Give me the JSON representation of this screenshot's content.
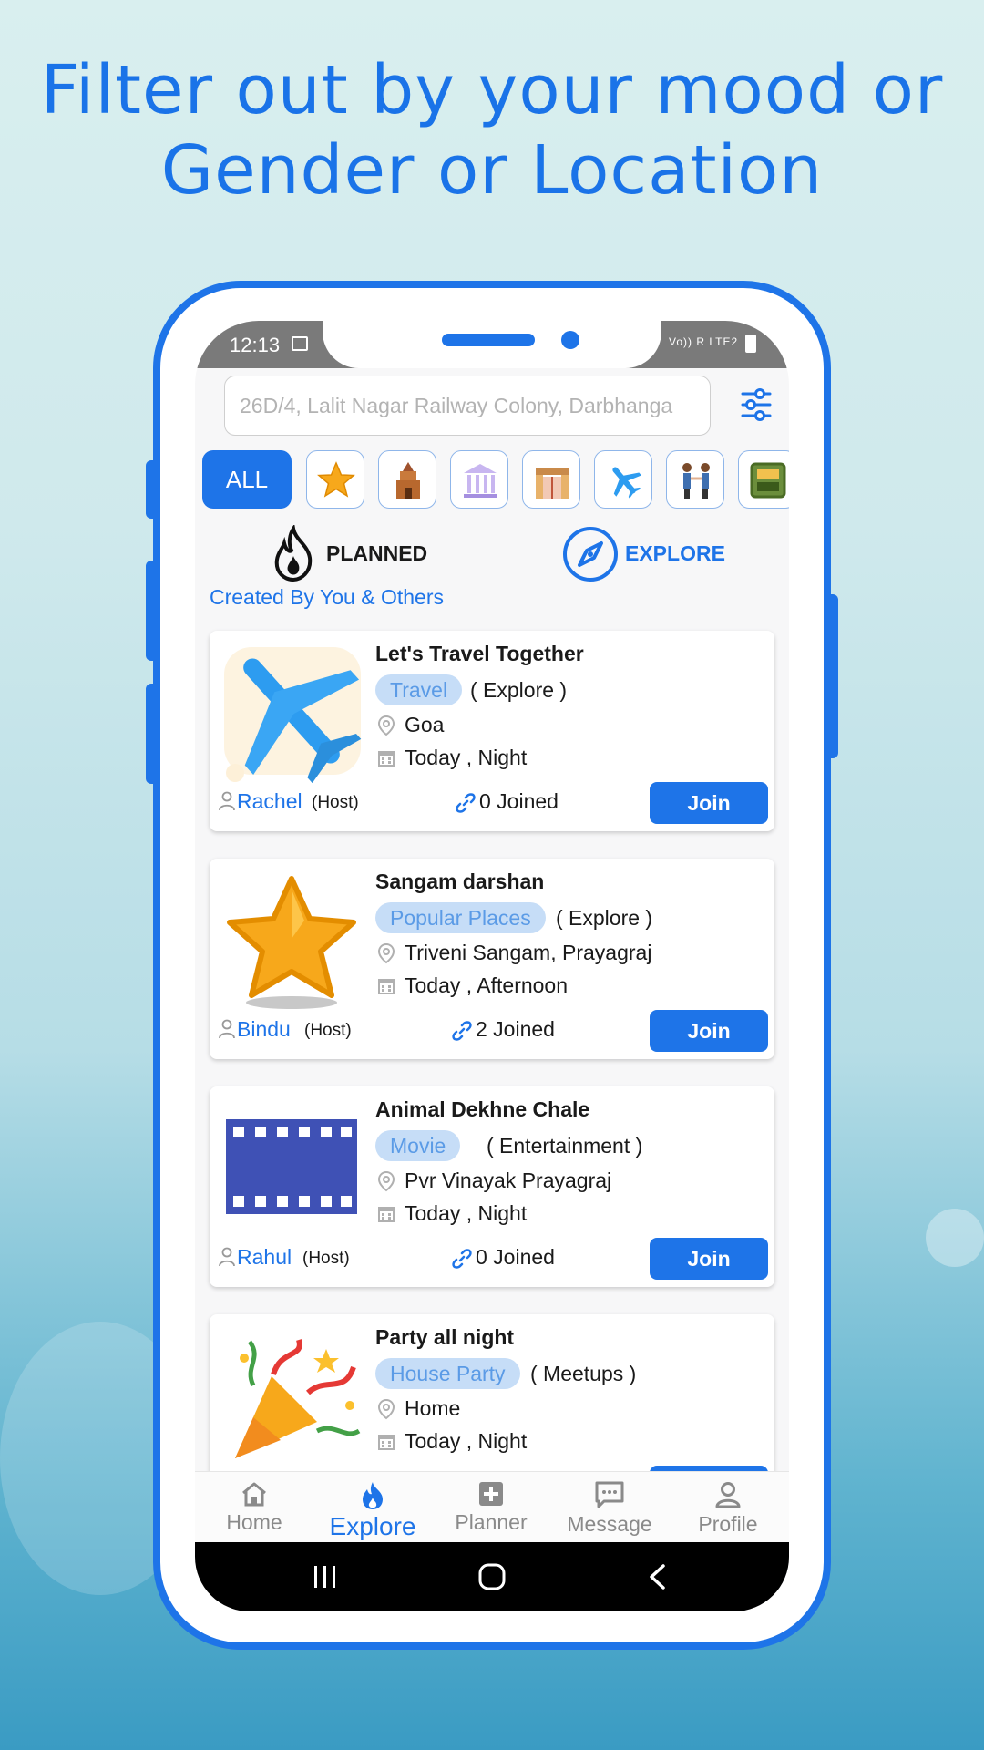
{
  "headline": {
    "line1": "Filter out by your mood or",
    "line2": "Gender or Location"
  },
  "status_bar": {
    "time": "12:13",
    "network": "Vo)) R LTE2"
  },
  "search": {
    "value": "26D/4, Lalit Nagar Railway Colony, Darbhanga"
  },
  "categories": {
    "all_label": "ALL",
    "icons": [
      "star-icon",
      "temple-icon",
      "museum-icon",
      "zoo-icon",
      "airplane-icon",
      "meetup-icon",
      "pub-icon"
    ]
  },
  "modes": {
    "planned": "PLANNED",
    "explore": "EXPLORE",
    "active": "explore"
  },
  "section_label": "Created By You & Others",
  "events": [
    {
      "title": "Let's Travel Together",
      "tag": "Travel",
      "category": "( Explore )",
      "location": "Goa",
      "when": "Today , Night",
      "host": "Rachel",
      "host_label": "(Host)",
      "joined": "0 Joined",
      "join_label": "Join",
      "thumb": "airplane-icon"
    },
    {
      "title": "Sangam darshan",
      "tag": "Popular Places",
      "category": "( Explore )",
      "location": "Triveni Sangam, Prayagraj",
      "when": "Today , Afternoon",
      "host": "Bindu",
      "host_label": "(Host)",
      "joined": "2 Joined",
      "join_label": "Join",
      "thumb": "star-icon"
    },
    {
      "title": "Animal Dekhne Chale",
      "tag": "Movie",
      "category": "( Entertainment )",
      "location": "Pvr Vinayak Prayagraj",
      "when": "Today , Night",
      "host": "Rahul",
      "host_label": "(Host)",
      "joined": "0 Joined",
      "join_label": "Join",
      "thumb": "film-strip-icon"
    },
    {
      "title": "Party all night",
      "tag": "House Party",
      "category": "( Meetups )",
      "location": "Home",
      "when": "Today , Night",
      "host": "",
      "host_label": "",
      "joined": "",
      "join_label": "",
      "thumb": "party-popper-icon"
    }
  ],
  "nav": {
    "home": "Home",
    "explore": "Explore",
    "planner": "Planner",
    "message": "Message",
    "profile": "Profile",
    "active": "explore"
  },
  "colors": {
    "accent": "#1e74e8",
    "tag_bg": "#c6ddf7",
    "tag_text": "#5b9be6"
  }
}
